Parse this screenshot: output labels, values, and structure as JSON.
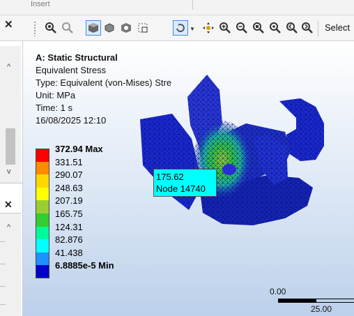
{
  "ribbon": {
    "tab_label": "Insert"
  },
  "toolbar": {
    "close_label": "✕",
    "select_label": "Select",
    "buttons": [
      "zoom-to-fit-icon",
      "zoom-box-icon",
      "isometric-view-icon",
      "wireframe-icon",
      "model-display-icon",
      "mesh-box-icon",
      "rotate-icon",
      "pan-icon",
      "zoom-in-icon",
      "zoom-out-icon",
      "zoom-region-icon",
      "zoom-fit-icon",
      "zoom-previous-icon"
    ]
  },
  "left": {
    "panel1_close": "✕",
    "panel2_close": "✕"
  },
  "result": {
    "title": "A: Static Structural",
    "result_name": "Equivalent Stress",
    "type": "Type: Equivalent (von-Mises) Stre",
    "unit": "Unit: MPa",
    "time": "Time: 1 s",
    "timestamp": "16/08/2025 12:10"
  },
  "legend": {
    "max_label": "372.94 Max",
    "values": [
      "331.51",
      "290.07",
      "248.63",
      "207.19",
      "165.75",
      "124.31",
      "82.876",
      "41.438"
    ],
    "min_label": "6.8885e-5 Min",
    "colors": [
      "#ff0000",
      "#ff8c00",
      "#ffd700",
      "#ffff00",
      "#9acd32",
      "#32cd32",
      "#00fa9a",
      "#00ffff",
      "#1e90ff",
      "#0000cd"
    ]
  },
  "probe": {
    "value": "175.62",
    "node": "Node 14740"
  },
  "scale": {
    "start": "0.00",
    "mid": "25.00"
  }
}
